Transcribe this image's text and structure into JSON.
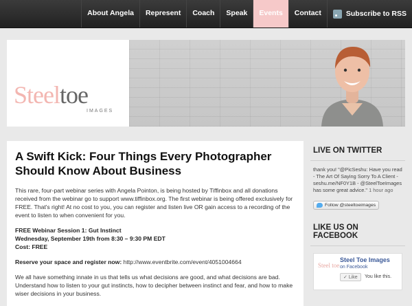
{
  "nav": {
    "items": [
      "About Angela",
      "Represent",
      "Coach",
      "Speak",
      "Events",
      "Contact"
    ],
    "active": "Events",
    "rss_label": "Subscribe to RSS"
  },
  "header": {
    "logo_part1": "Steel",
    "logo_part2": "toe",
    "logo_sub": "IMAGES"
  },
  "article": {
    "title": "A Swift Kick: Four Things Every Photographer Should Know About Business",
    "intro_pre": "This rare, four-part webinar series with Angela Pointon, is being hosted by ",
    "intro_org": "Tiffinbox",
    "intro_mid": " and all donations received from the webinar go to support ",
    "intro_site": "www.tiffinbox.org",
    "intro_post": ". The first webinar is being offered exclusively for FREE. That's right! At no cost to you, you can register and listen live OR gain access to a recording of the event to listen to when convenient for you.",
    "session_line": "FREE Webinar Session 1: Gut Instinct",
    "date_line": "Wednesday, September 19th from 8:30 – 9:30 PM EDT",
    "cost_line": "Cost: FREE",
    "reserve_label": "Reserve your space and register now:",
    "reserve_url": "http://www.eventbrite.com/event/4051004664",
    "body_text": "We all have something innate in us that tells us what decisions are good, and what decisions are bad. Understand how to listen to your gut instincts, how to decipher between instinct and fear, and how to make wiser decisions in your business."
  },
  "sidebar": {
    "twitter_heading": "LIVE ON TWITTER",
    "tweet_text": "thank you! \"@PicSeshu: Have you read - The Art Of Saying Sorry To A Client - seshu.me/NF0Y1B - @SteelToeImages has some great advice.\"",
    "tweet_time": "1 hour ago",
    "follow_label": "Follow @steeltoeimages",
    "facebook_heading": "LIKE US ON FACEBOOK",
    "fb_name": "Steel Toe Images",
    "fb_sub": "on Facebook",
    "fb_like_button": "Like",
    "fb_like_text": "You like this."
  }
}
